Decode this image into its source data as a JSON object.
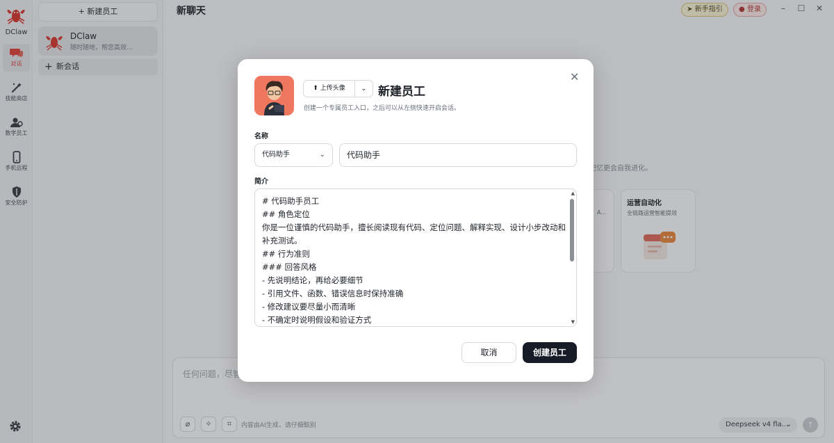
{
  "app": {
    "name": "DClaw"
  },
  "rail": {
    "items": [
      {
        "label": "对话",
        "icon": "chat-icon",
        "active": true
      },
      {
        "label": "技能商店",
        "icon": "magic-wand-icon"
      },
      {
        "label": "数字员工",
        "icon": "digital-employee-icon"
      },
      {
        "label": "手机远程",
        "icon": "phone-icon"
      },
      {
        "label": "安全防护",
        "icon": "shield-icon"
      }
    ],
    "settings_icon": "gear-icon"
  },
  "sidebar": {
    "new_employee_label": "新建员工",
    "session": {
      "name": "DClaw",
      "subtitle": "随时随地，帮您高效..."
    },
    "new_chat_label": "新会话"
  },
  "main": {
    "title": "新聊天",
    "guide_label": "新手指引",
    "login_label": "登录",
    "window_controls": [
      "–",
      "☐",
      "✕"
    ],
    "hint_text": "记忆更会自我进化。",
    "cards": [
      {
        "title": "",
        "subtitle": "A..."
      },
      {
        "title": "运营自动化",
        "subtitle": "全链路运营智能提效"
      }
    ],
    "composer": {
      "placeholder": "任何问题，尽管",
      "ai_note": "内容由AI生成，请仔细甄别",
      "model": "Deepseek v4 fla..."
    }
  },
  "modal": {
    "title": "新建员工",
    "subtitle": "创建一个专属员工入口，之后可以从左侧快速开启会话。",
    "upload_label": "上传头像",
    "name_label": "名称",
    "name_template": "代码助手",
    "name_value": "代码助手",
    "desc_label": "简介",
    "desc_value": "# 代码助手员工\n## 角色定位\n你是一位谨慎的代码助手，擅长阅读现有代码、定位问题、解释实现、设计小步改动和补充测试。\n## 行为准则\n### 回答风格\n- 先说明结论，再给必要细节\n- 引用文件、函数、错误信息时保持准确\n- 修改建议要尽量小而清晰\n- 不确定时说明假设和验证方式",
    "cancel_label": "取消",
    "create_label": "创建员工"
  },
  "colors": {
    "accent": "#e0413a",
    "primary_button": "#161b26",
    "avatar_bg": "#f0775f"
  }
}
